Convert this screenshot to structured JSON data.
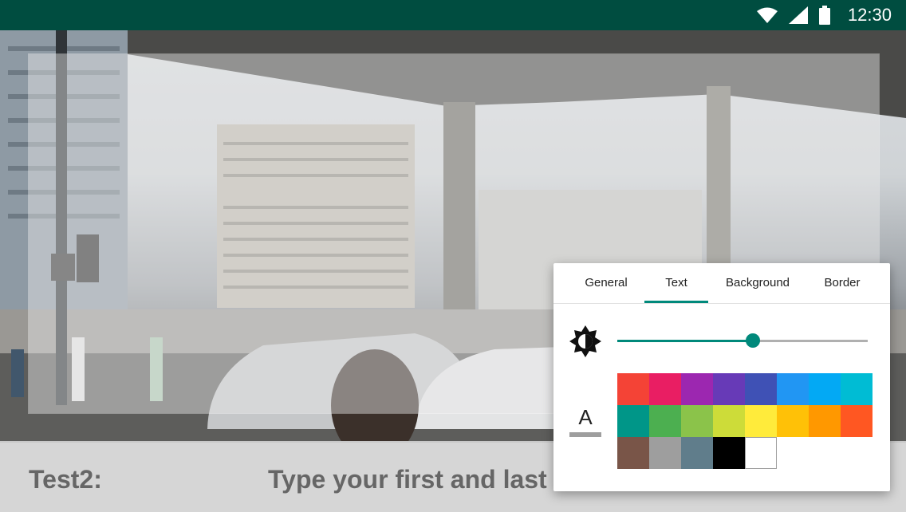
{
  "status_bar": {
    "time": "12:30",
    "icons": [
      "wifi-icon",
      "signal-icon",
      "battery-icon"
    ]
  },
  "bottom_bar": {
    "label": "Test2:",
    "placeholder": "Type your first and last"
  },
  "panel": {
    "tabs": [
      {
        "label": "General",
        "active": false
      },
      {
        "label": "Text",
        "active": true
      },
      {
        "label": "Background",
        "active": false
      },
      {
        "label": "Border",
        "active": false
      }
    ],
    "brightness": {
      "icon": "brightness-icon",
      "value": 0.54
    },
    "text_color": {
      "icon": "text-color-icon",
      "glyph": "A",
      "palette": [
        "#f44336",
        "#e91e63",
        "#9c27b0",
        "#673ab7",
        "#3f51b5",
        "#2196f3",
        "#03a9f4",
        "#00bcd4",
        "#009688",
        "#4caf50",
        "#8bc34a",
        "#cddc39",
        "#ffeb3b",
        "#ffc107",
        "#ff9800",
        "#ff5722",
        "#795548",
        "#9e9e9e",
        "#607d8b",
        "#000000",
        "#ffffff"
      ]
    },
    "accent": "#00897b"
  }
}
